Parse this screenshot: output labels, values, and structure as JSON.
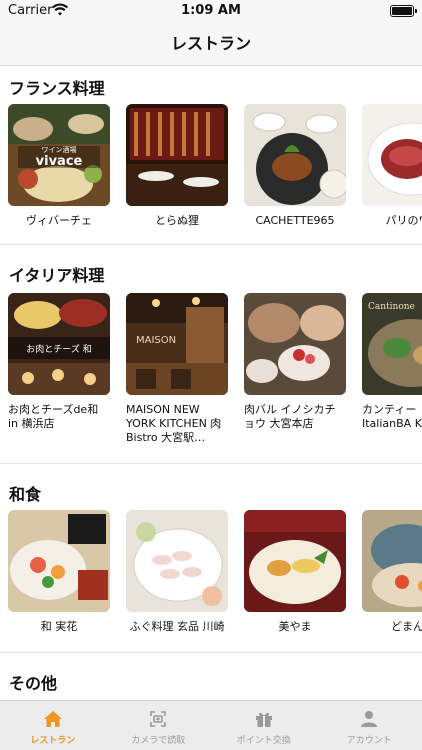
{
  "status_bar": {
    "carrier": "Carrier",
    "time": "1:09 AM"
  },
  "nav": {
    "title": "レストラン"
  },
  "sections": [
    {
      "title": "フランス料理",
      "items": [
        {
          "name": "ヴィバーチェ",
          "photo_text": "vivace",
          "photo_sub": "ワイン酒場"
        },
        {
          "name": "とらぬ狸"
        },
        {
          "name": "CACHETTE965"
        },
        {
          "name": "パリのワイ"
        }
      ]
    },
    {
      "title": "イタリア料理",
      "items": [
        {
          "name": "お肉とチーズde和 in 横浜店",
          "photo_text": "お肉とチーズ 和"
        },
        {
          "name": "MAISON NEW YORK KITCHEN 肉Bistro 大宮駅…",
          "photo_text": "MAISON"
        },
        {
          "name": "肉バル イノシカチョウ 大宮本店"
        },
        {
          "name": "カンティー ItalianBA KIMURAY",
          "photo_text": "Cantinone"
        }
      ]
    },
    {
      "title": "和食",
      "items": [
        {
          "name": "和 実花"
        },
        {
          "name": "ふぐ料理 玄品 川崎"
        },
        {
          "name": "美やま"
        },
        {
          "name": "どまん中 "
        }
      ]
    },
    {
      "title": "その他",
      "items": []
    }
  ],
  "tabs": [
    {
      "label": "レストラン",
      "icon": "home-icon",
      "active": true
    },
    {
      "label": "カメラで読取",
      "icon": "camera-scan-icon",
      "active": false
    },
    {
      "label": "ポイント交換",
      "icon": "gift-icon",
      "active": false
    },
    {
      "label": "アカウント",
      "icon": "person-icon",
      "active": false
    }
  ],
  "colors": {
    "accent": "#f0961e",
    "inactive": "#9a9a9a"
  }
}
